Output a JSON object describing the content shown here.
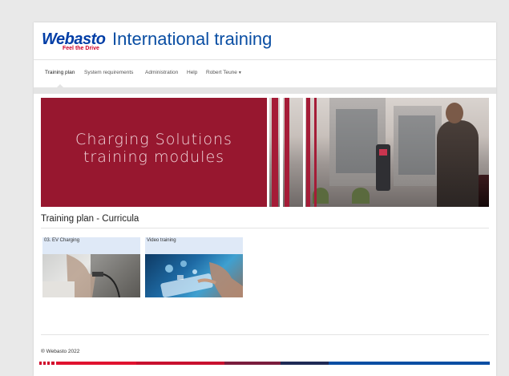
{
  "header": {
    "logo_text": "Webasto",
    "logo_tagline": "Feel the Drive",
    "title": "International training"
  },
  "nav": {
    "items": [
      {
        "label": "Training plan",
        "active": true
      },
      {
        "label": "System requirements",
        "active": false
      },
      {
        "label": "Administration",
        "active": false
      },
      {
        "label": "Help",
        "active": false
      },
      {
        "label": "Robert Teune",
        "active": false,
        "has_dropdown": true
      }
    ],
    "dropdown_icon": "caret-down-icon"
  },
  "banner": {
    "line1": "Charging Solutions",
    "line2": "training modules"
  },
  "main": {
    "section_title": "Training plan - Curricula",
    "tiles": [
      {
        "label": "03. EV Charging"
      },
      {
        "label": "Video training"
      }
    ]
  },
  "footer": {
    "copyright": "® Webasto 2022"
  },
  "colors": {
    "brand_blue": "#0a4ea3",
    "brand_red": "#d0002a",
    "banner_red": "#97172f",
    "tile_bg": "#dfe9f7"
  }
}
